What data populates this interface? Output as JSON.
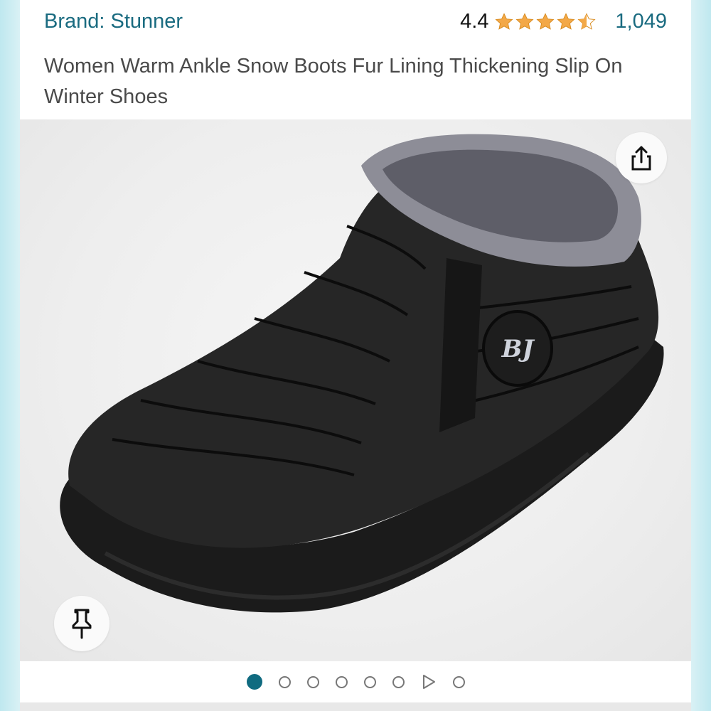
{
  "brand": {
    "label": "Brand: Stunner"
  },
  "rating": {
    "value": "4.4",
    "stars": 4.4,
    "reviews": "1,049"
  },
  "product": {
    "title": "Women Warm Ankle Snow Boots Fur Lining Thickening Slip On Winter Shoes",
    "logo_text": "BJ"
  },
  "carousel": {
    "total": 8,
    "active_index": 0,
    "video_index": 6
  },
  "icons": {
    "share": "share-icon",
    "pin": "pushpin-icon",
    "play": "play-icon",
    "star": "star-icon"
  },
  "colors": {
    "link": "#1a6b80",
    "star": "#f3a847",
    "active_dot": "#106b80"
  }
}
